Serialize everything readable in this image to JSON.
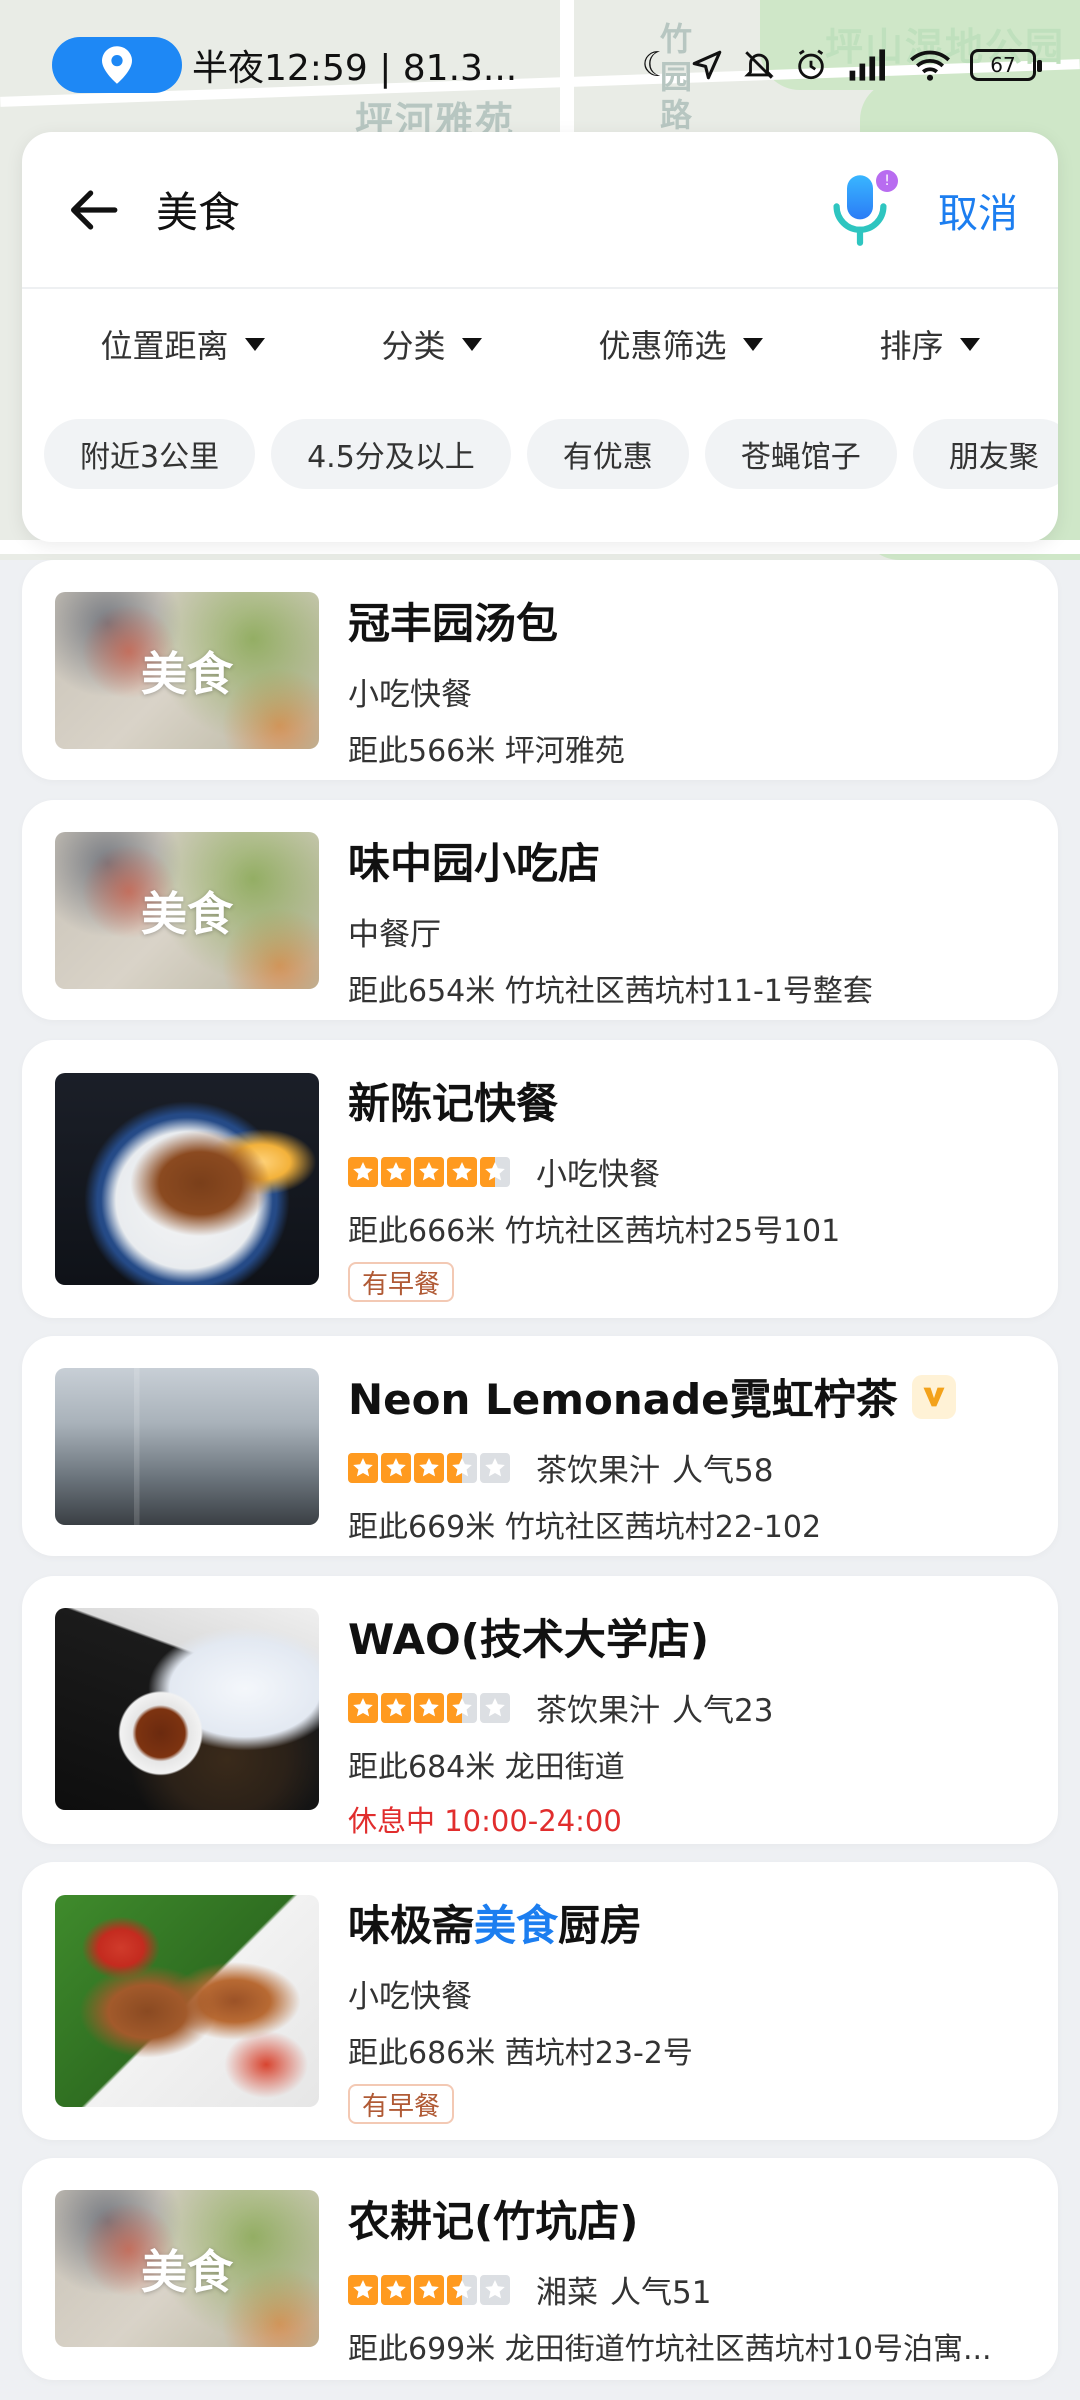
{
  "status_bar": {
    "text": "半夜12:59 | 81.3...",
    "battery": "67"
  },
  "map": {
    "labels": [
      "坪河雅苑",
      "竹园路",
      "坪山湿地公园"
    ]
  },
  "search": {
    "query": "美食",
    "cancel_label": "取消"
  },
  "filters": [
    {
      "label": "位置距离"
    },
    {
      "label": "分类"
    },
    {
      "label": "优惠筛选"
    },
    {
      "label": "排序"
    }
  ],
  "chips": [
    "附近3公里",
    "4.5分及以上",
    "有优惠",
    "苍蝇馆子",
    "朋友聚"
  ],
  "results": [
    {
      "name": "冠丰园汤包",
      "thumb_label": "美食",
      "category": "小吃快餐",
      "distance": "距此566米 坪河雅苑"
    },
    {
      "name": "味中园小吃店",
      "thumb_label": "美食",
      "category": "中餐厅",
      "distance": "距此654米 竹坑社区茜坑村11-1号整套"
    },
    {
      "name": "新陈记快餐",
      "rating": 4.5,
      "category": "小吃快餐",
      "distance": "距此666米 竹坑社区茜坑村25号101",
      "tag": "有早餐"
    },
    {
      "name": "Neon Lemonade霓虹柠茶",
      "rating": 3.5,
      "category": "茶饮果汁",
      "popularity": "人气58",
      "distance": "距此669米 竹坑社区茜坑村22-102"
    },
    {
      "name": "WAO(技术大学店)",
      "rating": 3.5,
      "category": "茶饮果汁",
      "popularity": "人气23",
      "distance": "距此684米 龙田街道",
      "status": "休息中 10:00-24:00"
    },
    {
      "name_prefix": "味极斋",
      "name_highlight": "美食",
      "name_suffix": "厨房",
      "category": "小吃快餐",
      "distance": "距此686米 茜坑村23-2号",
      "tag": "有早餐"
    },
    {
      "name": "农耕记(竹坑店)",
      "thumb_label": "美食",
      "rating": 3.5,
      "category": "湘菜",
      "popularity": "人气51",
      "distance": "距此699米 龙田街道竹坑社区茜坑村10号泊寓..."
    }
  ],
  "colors": {
    "accent": "#1c7ef0",
    "star": "#ff9a1f",
    "closed": "#e12d2d"
  }
}
